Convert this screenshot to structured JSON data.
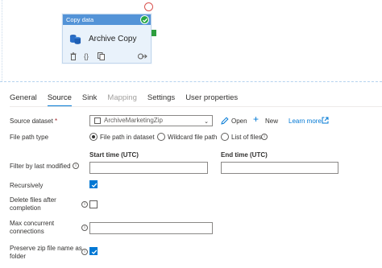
{
  "activity": {
    "header": "Copy data",
    "name": "Archive Copy",
    "status": "succeeded"
  },
  "tabs": [
    {
      "label": "General",
      "active": false,
      "disabled": false
    },
    {
      "label": "Source",
      "active": true,
      "disabled": false
    },
    {
      "label": "Sink",
      "active": false,
      "disabled": false
    },
    {
      "label": "Mapping",
      "active": false,
      "disabled": true
    },
    {
      "label": "Settings",
      "active": false,
      "disabled": false
    },
    {
      "label": "User properties",
      "active": false,
      "disabled": false
    }
  ],
  "source": {
    "dataset_label": "Source dataset",
    "dataset_required": "*",
    "dataset_value": "ArchiveMarketingZip",
    "open_label": "Open",
    "new_label": "New",
    "learn_more_label": "Learn more"
  },
  "file_path": {
    "label": "File path type",
    "options": [
      {
        "label": "File path in dataset",
        "selected": true
      },
      {
        "label": "Wildcard file path",
        "selected": false
      },
      {
        "label": "List of files",
        "selected": false
      }
    ]
  },
  "filter": {
    "label": "Filter by last modified",
    "start_label": "Start time (UTC)",
    "end_label": "End time (UTC)",
    "start_value": "",
    "end_value": ""
  },
  "recursively": {
    "label": "Recursively",
    "checked": true
  },
  "delete_files": {
    "label_line1": "Delete files after",
    "label_line2": "completion",
    "checked": false
  },
  "max_connections": {
    "label_line1": "Max concurrent",
    "label_line2": "connections",
    "value": ""
  },
  "preserve_zip": {
    "label_line1": "Preserve zip file name as",
    "label_line2": "folder",
    "checked": true
  },
  "colors": {
    "accent": "#0078d4",
    "header": "#5393d7",
    "success": "#28a745",
    "error": "#d9534f"
  }
}
